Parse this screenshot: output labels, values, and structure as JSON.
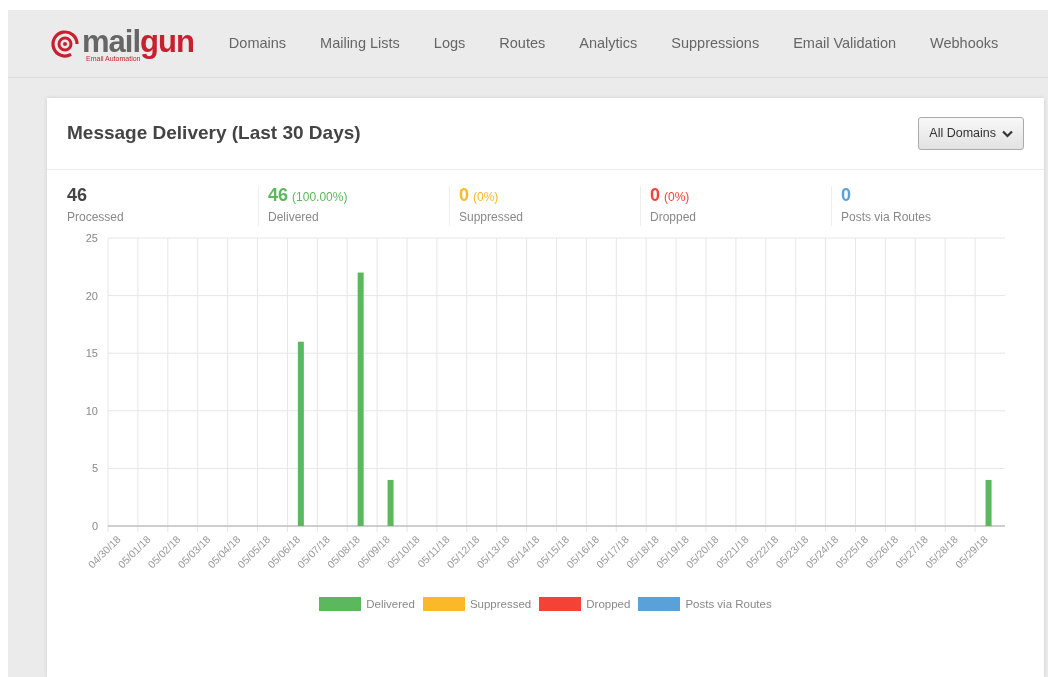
{
  "logo": {
    "brand": [
      "mail",
      "gun"
    ],
    "tagline": "Email Automation"
  },
  "nav": [
    "Domains",
    "Mailing Lists",
    "Logs",
    "Routes",
    "Analytics",
    "Suppressions",
    "Email Validation",
    "Webhooks"
  ],
  "panel": {
    "title": "Message Delivery (Last 30 Days)",
    "filter_button": "All Domains"
  },
  "stats": [
    {
      "value": "46",
      "label": "Processed",
      "color": "#444444"
    },
    {
      "value": "46",
      "percent": "(100.00%)",
      "label": "Delivered",
      "color": "#5cb85c"
    },
    {
      "value": "0",
      "percent": "(0%)",
      "label": "Suppressed",
      "color": "#fbb829"
    },
    {
      "value": "0",
      "percent": "(0%)",
      "label": "Dropped",
      "color": "#f44336"
    },
    {
      "value": "0",
      "label": "Posts via Routes",
      "color": "#5aa1da"
    }
  ],
  "chart_data": {
    "type": "bar",
    "stacked": true,
    "grid": true,
    "categories": [
      "04/30/18",
      "05/01/18",
      "05/02/18",
      "05/03/18",
      "05/04/18",
      "05/05/18",
      "05/06/18",
      "05/07/18",
      "05/08/18",
      "05/09/18",
      "05/10/18",
      "05/11/18",
      "05/12/18",
      "05/13/18",
      "05/14/18",
      "05/15/18",
      "05/16/18",
      "05/17/18",
      "05/18/18",
      "05/19/18",
      "05/20/18",
      "05/21/18",
      "05/22/18",
      "05/23/18",
      "05/24/18",
      "05/25/18",
      "05/26/18",
      "05/27/18",
      "05/28/18",
      "05/29/18"
    ],
    "ylim": [
      0,
      25
    ],
    "yticks": [
      0,
      5,
      10,
      15,
      20,
      25
    ],
    "series": [
      {
        "name": "Delivered",
        "color": "#5cb85c",
        "values": [
          0,
          0,
          0,
          0,
          0,
          0,
          16,
          0,
          22,
          4,
          0,
          0,
          0,
          0,
          0,
          0,
          0,
          0,
          0,
          0,
          0,
          0,
          0,
          0,
          0,
          0,
          0,
          0,
          0,
          4
        ]
      },
      {
        "name": "Suppressed",
        "color": "#fbb829",
        "values": [
          0,
          0,
          0,
          0,
          0,
          0,
          0,
          0,
          0,
          0,
          0,
          0,
          0,
          0,
          0,
          0,
          0,
          0,
          0,
          0,
          0,
          0,
          0,
          0,
          0,
          0,
          0,
          0,
          0,
          0
        ]
      },
      {
        "name": "Dropped",
        "color": "#f44336",
        "values": [
          0,
          0,
          0,
          0,
          0,
          0,
          0,
          0,
          0,
          0,
          0,
          0,
          0,
          0,
          0,
          0,
          0,
          0,
          0,
          0,
          0,
          0,
          0,
          0,
          0,
          0,
          0,
          0,
          0,
          0
        ]
      },
      {
        "name": "Posts via Routes",
        "color": "#5aa1da",
        "values": [
          0,
          0,
          0,
          0,
          0,
          0,
          0,
          0,
          0,
          0,
          0,
          0,
          0,
          0,
          0,
          0,
          0,
          0,
          0,
          0,
          0,
          0,
          0,
          0,
          0,
          0,
          0,
          0,
          0,
          0
        ]
      }
    ]
  }
}
